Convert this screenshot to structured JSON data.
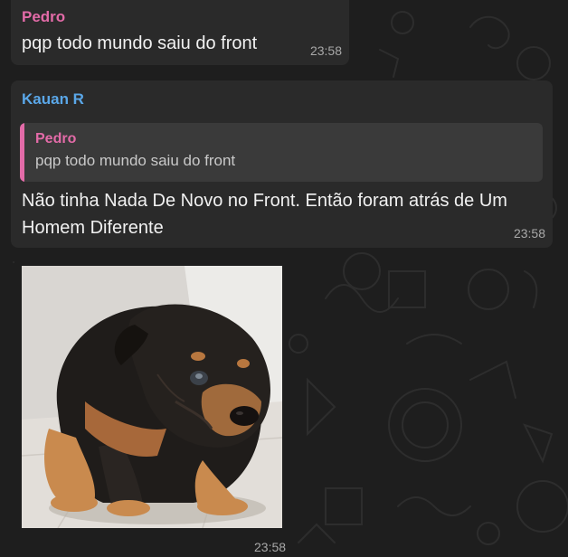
{
  "colors": {
    "background": "#1e1e1e",
    "bubble": "#2a2a2a",
    "quote_bg": "#3a3a3a",
    "pedro_name": "#e36ba8",
    "kauan_name": "#5aa7e8",
    "timestamp": "#a8a8a8"
  },
  "messages": [
    {
      "sender": "Pedro",
      "text": "pqp todo mundo saiu do front",
      "time": "23:58"
    },
    {
      "sender": "Kauan R",
      "quote": {
        "sender": "Pedro",
        "text": "pqp todo mundo saiu do front"
      },
      "text": "Não tinha Nada De Novo no Front. Então foram atrás de Um Homem Diferente",
      "time": "23:58"
    },
    {
      "image": "puppy-photo",
      "time": "23:58"
    }
  ]
}
